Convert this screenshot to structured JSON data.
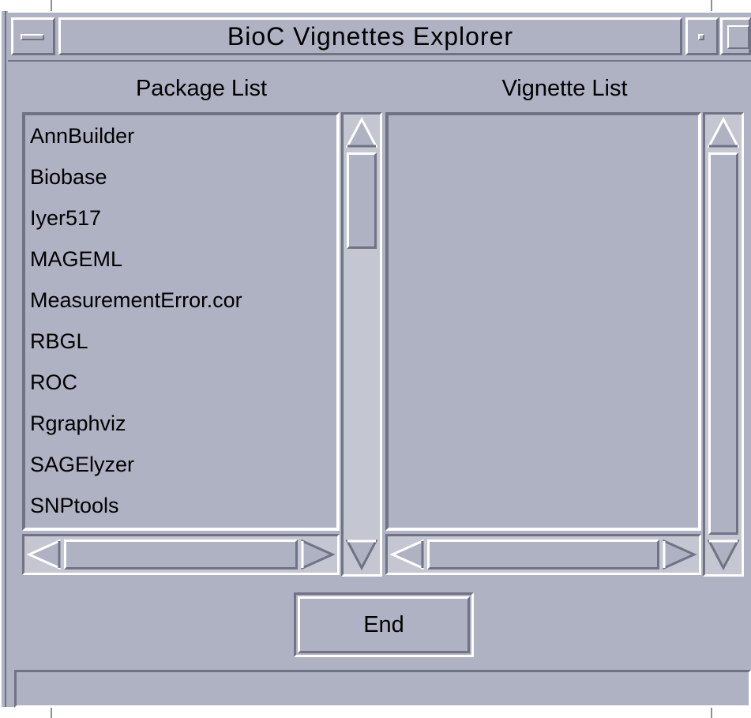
{
  "window": {
    "title": "BioC Vignettes Explorer"
  },
  "package_panel": {
    "header": "Package List",
    "items": [
      "AnnBuilder",
      "Biobase",
      "Iyer517",
      "MAGEML",
      "MeasurementError.cor",
      "RBGL",
      "ROC",
      "Rgraphviz",
      "SAGElyzer",
      "SNPtools"
    ]
  },
  "vignette_panel": {
    "header": "Vignette List",
    "items": []
  },
  "end_button": {
    "label": "End"
  },
  "status_bar": {
    "text": ""
  },
  "icons": {
    "window_menu": "window-menu-icon",
    "minimize": "minimize-icon",
    "maximize": "maximize-icon",
    "scroll_up": "arrow-up-icon",
    "scroll_down": "arrow-down-icon",
    "scroll_left": "arrow-left-icon",
    "scroll_right": "arrow-right-icon"
  },
  "colors": {
    "background": "#aeb2c3",
    "highlight": "#ffffff",
    "shadow": "#6f7384",
    "trough": "#c4c7d1"
  }
}
